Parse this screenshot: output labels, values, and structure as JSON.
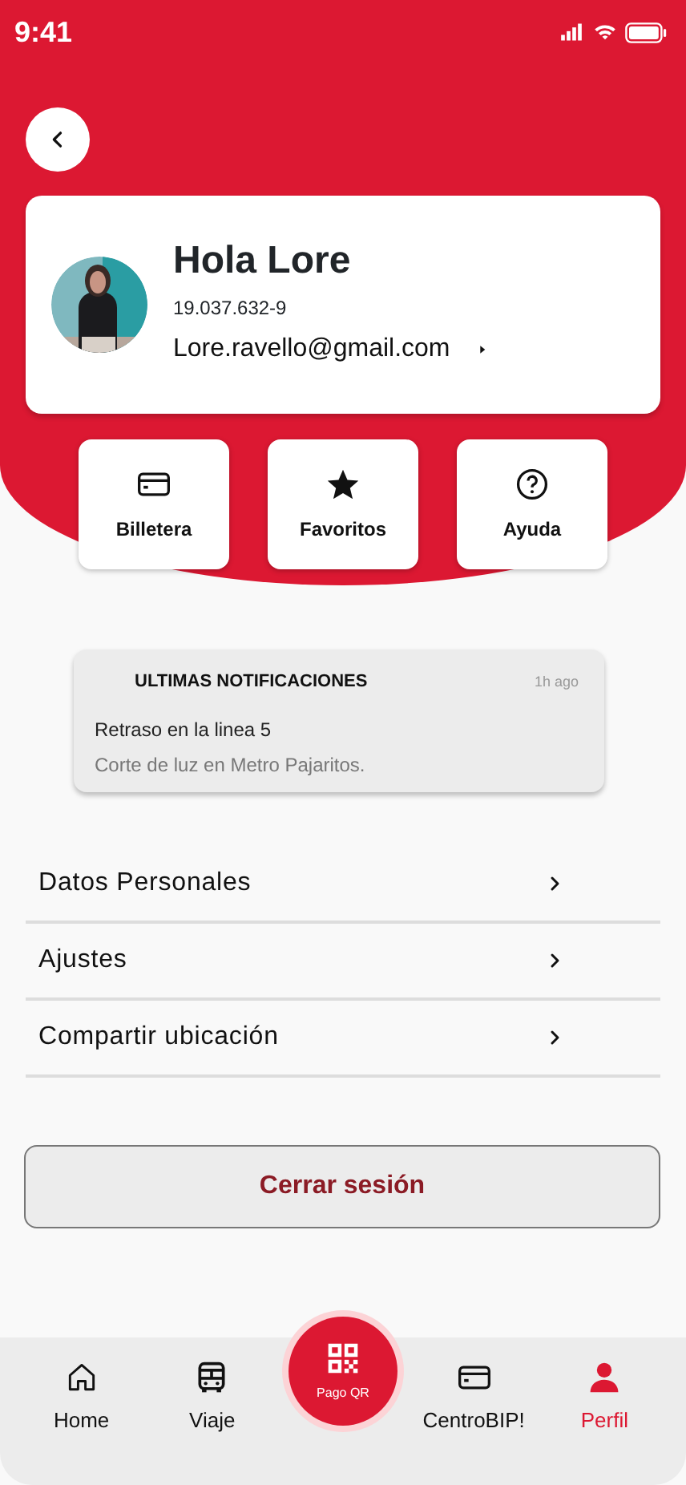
{
  "status_bar": {
    "time": "9:41"
  },
  "profile": {
    "greeting": "Hola Lore",
    "rut": "19.037.632-9",
    "email": "Lore.ravello@gmail.com"
  },
  "shortcuts": [
    {
      "label": "Billetera"
    },
    {
      "label": "Favoritos"
    },
    {
      "label": "Ayuda"
    }
  ],
  "notifications": {
    "title": "ULTIMAS NOTIFICACIONES",
    "time": "1h ago",
    "headline": "Retraso en la linea 5",
    "detail": "Corte de luz en Metro Pajaritos."
  },
  "menu": [
    {
      "label": "Datos Personales"
    },
    {
      "label": "Ajustes"
    },
    {
      "label": "Compartir ubicación"
    }
  ],
  "logout_button": "Cerrar sesión",
  "bottom_nav": [
    {
      "label": "Home",
      "selected": false
    },
    {
      "label": "Viaje",
      "selected": false
    },
    {
      "label": "Pago QR",
      "selected": false
    },
    {
      "label": "CentroBIP!",
      "selected": false
    },
    {
      "label": "Perfil",
      "selected": true
    }
  ]
}
